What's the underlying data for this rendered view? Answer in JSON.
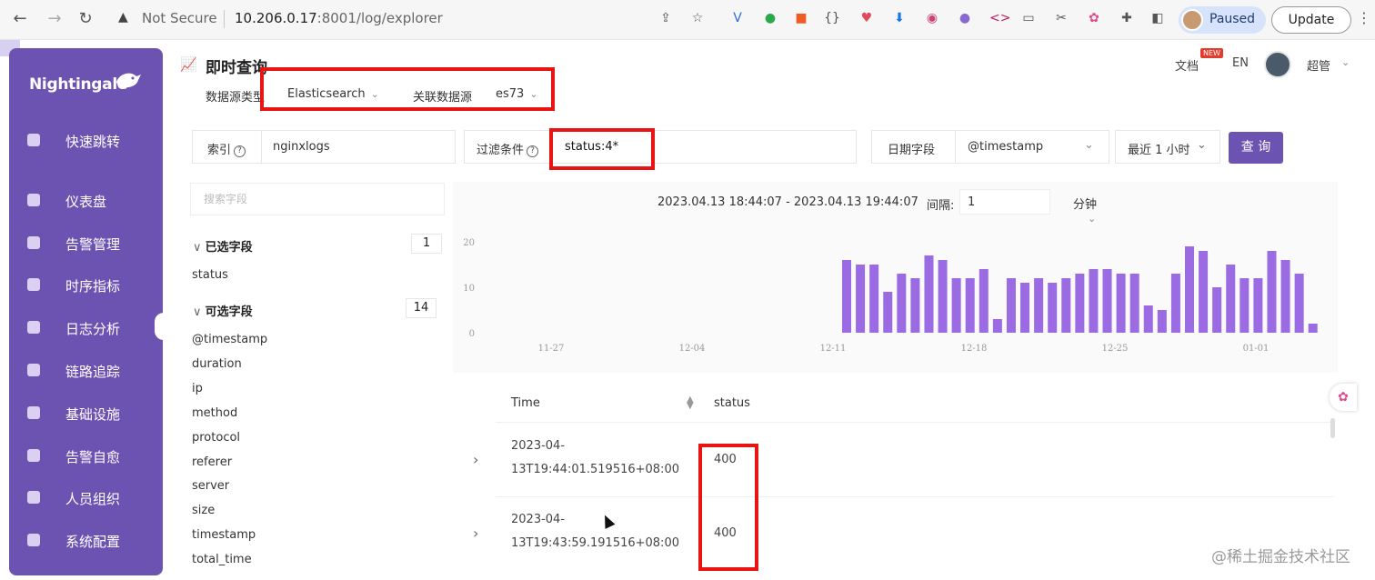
{
  "browser": {
    "not_secure": "Not Secure",
    "url_host": "10.206.0.17",
    "url_rest": ":8001/log/explorer",
    "profile_status": "Paused",
    "update_label": "Update"
  },
  "sidebar": {
    "logo": "Nightingale",
    "items": [
      {
        "label": "快速跳转",
        "icon": "search-icon"
      },
      {
        "label": "仪表盘",
        "icon": "dashboard-icon"
      },
      {
        "label": "告警管理",
        "icon": "alarm-icon"
      },
      {
        "label": "时序指标",
        "icon": "metrics-icon"
      },
      {
        "label": "日志分析",
        "icon": "log-icon"
      },
      {
        "label": "链路追踪",
        "icon": "trace-icon"
      },
      {
        "label": "基础设施",
        "icon": "infra-icon"
      },
      {
        "label": "告警自愈",
        "icon": "self-heal-icon"
      },
      {
        "label": "人员组织",
        "icon": "user-icon"
      },
      {
        "label": "系统配置",
        "icon": "settings-icon"
      }
    ]
  },
  "header": {
    "title": "即时查询",
    "docs": "文档",
    "new_badge": "NEW",
    "lang": "EN",
    "user": "超管"
  },
  "datasource": {
    "type_label": "数据源类型",
    "type_value": "Elasticsearch",
    "linked_label": "关联数据源",
    "linked_value": "es73"
  },
  "filters": {
    "index_label": "索引",
    "index_value": "nginxlogs",
    "filter_label": "过滤条件",
    "filter_value": "status:4*",
    "date_field_label": "日期字段",
    "date_field_value": "@timestamp",
    "time_range": "最近 1 小时",
    "query_button": "查 询"
  },
  "fields": {
    "search_placeholder": "搜索字段",
    "selected_title": "已选字段",
    "selected_count": "1",
    "selected": [
      "status"
    ],
    "available_title": "可选字段",
    "available_count": "14",
    "available": [
      "@timestamp",
      "duration",
      "ip",
      "method",
      "protocol",
      "referer",
      "server",
      "size",
      "timestamp",
      "total_time"
    ]
  },
  "histogram": {
    "range": "2023.04.13 18:44:07 - 2023.04.13 19:44:07",
    "interval_label": "间隔:",
    "interval_value": "1",
    "interval_unit": "分钟"
  },
  "chart_data": {
    "type": "bar",
    "x_ticks": [
      "11-27",
      "12-04",
      "12-11",
      "12-18",
      "12-25",
      "01-01"
    ],
    "y_ticks": [
      0,
      10,
      20
    ],
    "ylim": [
      0,
      20
    ],
    "bar_color": "#9b6be3",
    "first_bar_tick_offset": 0.85,
    "values": [
      16,
      15,
      15,
      9,
      13,
      12,
      17,
      16,
      12,
      12,
      14,
      3,
      12,
      11,
      12,
      11,
      12,
      13,
      14,
      14,
      13,
      13,
      6,
      5,
      13,
      19,
      18,
      10,
      15,
      12,
      12,
      18,
      16,
      13,
      2
    ]
  },
  "table": {
    "col_time": "Time",
    "col_status": "status",
    "rows": [
      {
        "time_line1": "2023-04-",
        "time_line2": "13T19:44:01.519516+08:00",
        "status": "400"
      },
      {
        "time_line1": "2023-04-",
        "time_line2": "13T19:43:59.191516+08:00",
        "status": "400"
      }
    ]
  },
  "watermark": "@稀土掘金技术社区"
}
